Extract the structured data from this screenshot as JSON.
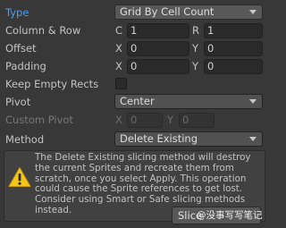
{
  "type_row": {
    "label": "Type",
    "value": "Grid By Cell Count"
  },
  "column_row": {
    "label": "Column & Row",
    "c_label": "C",
    "c_value": "1",
    "r_label": "R",
    "r_value": "1"
  },
  "offset_row": {
    "label": "Offset",
    "x_label": "X",
    "x_value": "0",
    "y_label": "Y",
    "y_value": "0"
  },
  "padding_row": {
    "label": "Padding",
    "x_label": "X",
    "x_value": "0",
    "y_label": "Y",
    "y_value": "0"
  },
  "keep_empty_rects": {
    "label": "Keep Empty Rects",
    "checked": false
  },
  "pivot_row": {
    "label": "Pivot",
    "value": "Center"
  },
  "custom_pivot_row": {
    "label": "Custom Pivot",
    "x_label": "X",
    "x_value": "0",
    "y_label": "Y",
    "y_value": "0"
  },
  "method_row": {
    "label": "Method",
    "value": "Delete Existing"
  },
  "warning": {
    "icon": "warning-triangle-icon",
    "text": "The Delete Existing slicing method will destroy the current Sprites and recreate them from scratch, once you select Apply. This operation could cause the Sprite references to get lost. Consider using Smart or Safe slicing methods instead."
  },
  "slice_button": {
    "label": "Slice"
  },
  "watermark": {
    "text": "@没事写写笔记"
  },
  "colors": {
    "background": "#383838",
    "label_active": "#4c9cf0",
    "warning_yellow": "#f5c518"
  }
}
